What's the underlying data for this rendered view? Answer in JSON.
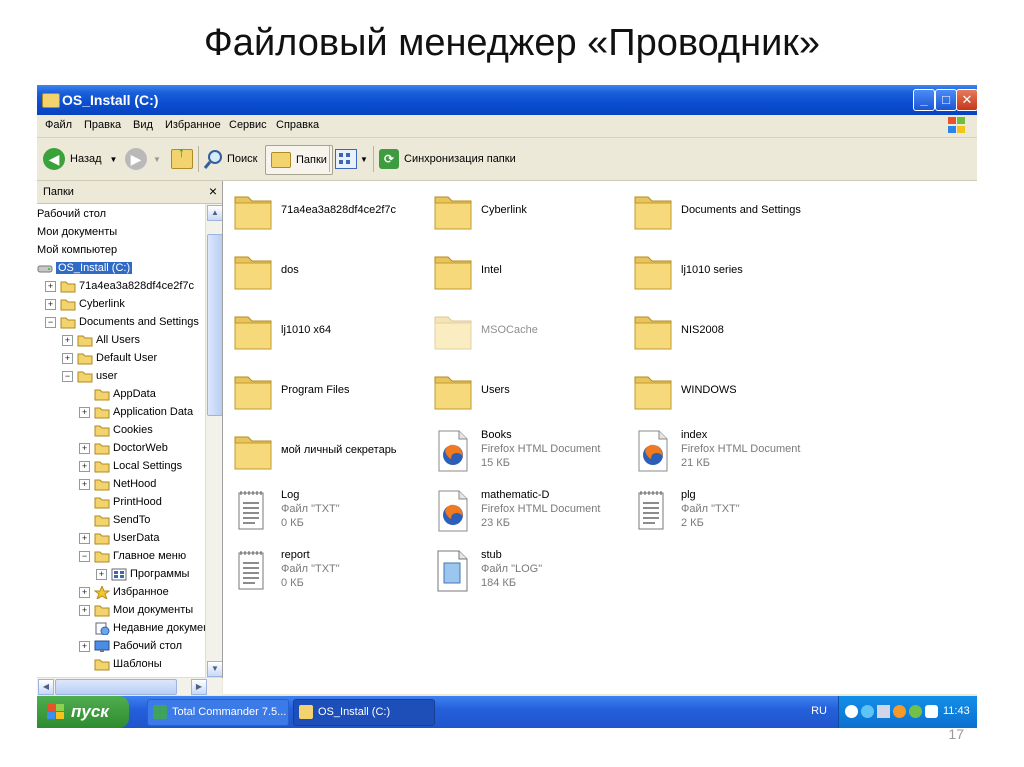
{
  "slide": {
    "title": "Файловый менеджер «Проводник»",
    "page_number": "17"
  },
  "window": {
    "title": "OS_Install (C:)",
    "controls": {
      "minimize": "_",
      "maximize": "□",
      "close": "✕"
    }
  },
  "menu": [
    "Файл",
    "Правка",
    "Вид",
    "Избранное",
    "Сервис",
    "Справка"
  ],
  "toolbar": {
    "back_label": "Назад",
    "search_label": "Поиск",
    "folders_label": "Папки",
    "sync_label": "Синхронизация папки"
  },
  "left_pane": {
    "header": "Папки",
    "close": "×",
    "tree": [
      {
        "label": "Рабочий стол",
        "depth": 0,
        "expander": "",
        "icon": "none"
      },
      {
        "label": "Мои документы",
        "depth": 0,
        "expander": "",
        "icon": "none"
      },
      {
        "label": "Мой компьютер",
        "depth": 0,
        "expander": "",
        "icon": "none"
      },
      {
        "label": "OS_Install (C:)",
        "depth": 0,
        "expander": "",
        "icon": "drive",
        "selected": true
      },
      {
        "label": "71a4ea3a828df4ce2f7c",
        "depth": 1,
        "expander": "+",
        "icon": "folder"
      },
      {
        "label": "Cyberlink",
        "depth": 1,
        "expander": "+",
        "icon": "folder"
      },
      {
        "label": "Documents and Settings",
        "depth": 1,
        "expander": "−",
        "icon": "folder"
      },
      {
        "label": "All Users",
        "depth": 2,
        "expander": "+",
        "icon": "folder"
      },
      {
        "label": "Default User",
        "depth": 2,
        "expander": "+",
        "icon": "folder"
      },
      {
        "label": "user",
        "depth": 2,
        "expander": "−",
        "icon": "folder"
      },
      {
        "label": "AppData",
        "depth": 3,
        "expander": "",
        "icon": "folder"
      },
      {
        "label": "Application Data",
        "depth": 3,
        "expander": "+",
        "icon": "folder"
      },
      {
        "label": "Cookies",
        "depth": 3,
        "expander": "",
        "icon": "folder"
      },
      {
        "label": "DoctorWeb",
        "depth": 3,
        "expander": "+",
        "icon": "folder"
      },
      {
        "label": "Local Settings",
        "depth": 3,
        "expander": "+",
        "icon": "folder"
      },
      {
        "label": "NetHood",
        "depth": 3,
        "expander": "+",
        "icon": "folder"
      },
      {
        "label": "PrintHood",
        "depth": 3,
        "expander": "",
        "icon": "folder"
      },
      {
        "label": "SendTo",
        "depth": 3,
        "expander": "",
        "icon": "folder"
      },
      {
        "label": "UserData",
        "depth": 3,
        "expander": "+",
        "icon": "folder"
      },
      {
        "label": "Главное меню",
        "depth": 3,
        "expander": "−",
        "icon": "folder"
      },
      {
        "label": "Программы",
        "depth": 4,
        "expander": "+",
        "icon": "programs"
      },
      {
        "label": "Избранное",
        "depth": 3,
        "expander": "+",
        "icon": "star"
      },
      {
        "label": "Мои документы",
        "depth": 3,
        "expander": "+",
        "icon": "folder"
      },
      {
        "label": "Недавние документ",
        "depth": 3,
        "expander": "",
        "icon": "recent"
      },
      {
        "label": "Рабочий стол",
        "depth": 3,
        "expander": "+",
        "icon": "desktop"
      },
      {
        "label": "Шаблоны",
        "depth": 3,
        "expander": "",
        "icon": "folder"
      }
    ]
  },
  "files": [
    {
      "name": "71a4ea3a828df4ce2f7c",
      "type": "folder"
    },
    {
      "name": "Cyberlink",
      "type": "folder"
    },
    {
      "name": "Documents and Settings",
      "type": "folder"
    },
    {
      "name": "dos",
      "type": "folder"
    },
    {
      "name": "Intel",
      "type": "folder"
    },
    {
      "name": "lj1010 series",
      "type": "folder"
    },
    {
      "name": "lj1010 x64",
      "type": "folder"
    },
    {
      "name": "MSOCache",
      "type": "folder",
      "hidden": true
    },
    {
      "name": "NIS2008",
      "type": "folder"
    },
    {
      "name": "Program Files",
      "type": "folder"
    },
    {
      "name": "Users",
      "type": "folder"
    },
    {
      "name": "WINDOWS",
      "type": "folder"
    },
    {
      "name": "мой личный секретарь",
      "type": "folder"
    },
    {
      "name": "Books",
      "type": "firefox",
      "kind": "Firefox HTML Document",
      "size": "15 КБ"
    },
    {
      "name": "index",
      "type": "firefox",
      "kind": "Firefox HTML Document",
      "size": "21 КБ"
    },
    {
      "name": "Log",
      "type": "txt",
      "kind": "Файл \"TXT\"",
      "size": "0 КБ"
    },
    {
      "name": "mathematic-D",
      "type": "firefox",
      "kind": "Firefox HTML Document",
      "size": "23 КБ"
    },
    {
      "name": "plg",
      "type": "txt",
      "kind": "Файл \"TXT\"",
      "size": "2 КБ"
    },
    {
      "name": "report",
      "type": "txt",
      "kind": "Файл \"TXT\"",
      "size": "0 КБ"
    },
    {
      "name": "stub",
      "type": "log",
      "kind": "Файл \"LOG\"",
      "size": "184 КБ"
    }
  ],
  "taskbar": {
    "start_label": "пуск",
    "tasks": [
      {
        "label": "Total Commander 7.5...",
        "active": false
      },
      {
        "label": "OS_Install (C:)",
        "active": true
      }
    ],
    "language": "RU",
    "clock": "11:43"
  },
  "colors": {
    "titlebar": "#0a4ed0",
    "selection": "#316ac5",
    "folder": "#f3d36e",
    "start": "#3c9a3c",
    "taskbar": "#2560db"
  }
}
